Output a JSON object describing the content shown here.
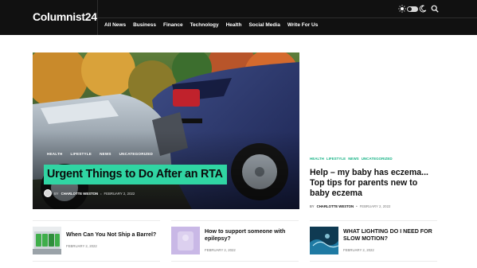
{
  "site": {
    "logo": "Columnist24",
    "nav": [
      "All News",
      "Business",
      "Finance",
      "Technology",
      "Health",
      "Social Media",
      "Write For Us"
    ]
  },
  "icons": {
    "sun": "sun-icon",
    "toggle": "dark-mode-toggle",
    "moon": "moon-icon",
    "search": "search-icon"
  },
  "hero": {
    "tags": [
      "HEALTH",
      "LIFESTYLE",
      "NEWS",
      "UNCATEGORIZED"
    ],
    "title": "Urgent Things to Do After an RTA",
    "by": "BY",
    "author": "CHARLOTTE WESTON",
    "separator": "•",
    "date": "FEBRUARY 2, 2022"
  },
  "side_article": {
    "tags": [
      "HEALTH",
      "LIFESTYLE",
      "NEWS",
      "UNCATEGORIZED"
    ],
    "title": "Help – my baby has eczema... Top tips for parents new to baby eczema",
    "by": "BY",
    "author": "CHARLOTTE WESTON",
    "separator": "•",
    "date": "FEBRUARY 2, 2022"
  },
  "cards": [
    {
      "title_lines": [
        "When Can You Not Ship a Barrel?"
      ],
      "date": "FEBRUARY 2, 2022"
    },
    {
      "title_lines": [
        "How to support someone with",
        "epilepsy?"
      ],
      "date": "FEBRUARY 2, 2022"
    },
    {
      "title_lines": [
        "WHAT LIGHTING DO I NEED FOR",
        "SLOW MOTION?"
      ],
      "date": "FEBRUARY 2, 2022"
    }
  ],
  "colors": {
    "header_bg": "#111111",
    "accent": "#30d5a3",
    "tag_green": "#19b487"
  }
}
